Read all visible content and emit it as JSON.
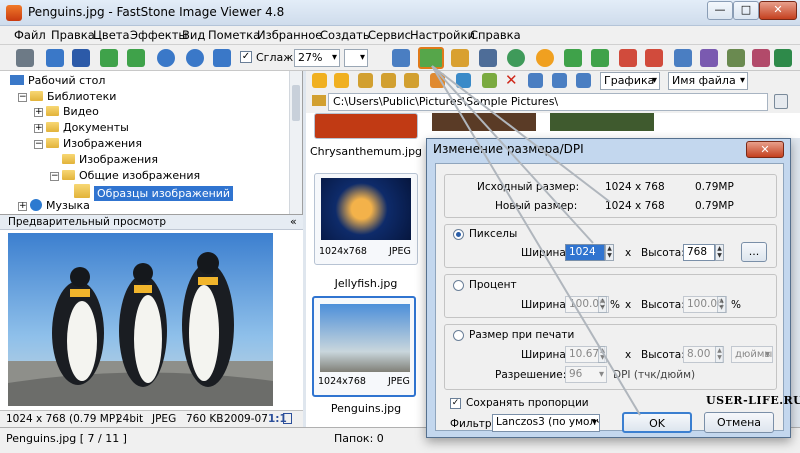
{
  "window": {
    "title": "Penguins.jpg  -  FastStone Image Viewer 4.8",
    "min_label": "—",
    "max_label": "□",
    "close_label": "✕"
  },
  "menu": [
    "Файл",
    "Правка",
    "Цвета",
    "Эффекты",
    "Вид",
    "Пометка",
    "Избранное",
    "Создать",
    "Сервис",
    "Настройки",
    "Справка"
  ],
  "toolbar1": {
    "smooth_label": "Сглаж.",
    "zoom_value": "27%"
  },
  "tree": {
    "desktop": "Рабочий стол",
    "libraries": "Библиотеки",
    "video": "Видео",
    "documents": "Документы",
    "images": "Изображения",
    "images_sub": "Изображения",
    "public_images": "Общие изображения",
    "sample_images": "Образцы изображений",
    "music": "Музыка"
  },
  "preview": {
    "header": "Предварительный просмотр",
    "header_icon": "«"
  },
  "infobar": {
    "dims": "1024 x 768 (0.79 MP)",
    "depth": "24bit",
    "format": "JPEG",
    "size": "760 KB",
    "date": "2009-07-14",
    "ratio": "1:1"
  },
  "status": {
    "file": "Penguins.jpg [ 7 / 11 ]",
    "folders": "Папок: 0"
  },
  "toolbar2": {
    "view_select": "Графика",
    "sort_select": "Имя файла"
  },
  "path": "C:\\Users\\Public\\Pictures\\Sample Pictures\\",
  "thumbnails": [
    {
      "name": "Chrysanthemum.jpg"
    },
    {
      "dims": "1024x768",
      "format": "JPEG",
      "name": "Jellyfish.jpg"
    },
    {
      "dims": "1024x768",
      "format": "JPEG",
      "name": "Penguins.jpg"
    }
  ],
  "dialog": {
    "title": "Изменение размера/DPI",
    "close": "✕",
    "orig_label": "Исходный размер:",
    "orig_dims": "1024 x 768",
    "orig_mp": "0.79MP",
    "new_label": "Новый размер:",
    "new_dims": "1024 x 768",
    "new_mp": "0.79MP",
    "pixels_label": "Пикселы",
    "width_label": "Ширина:",
    "height_label": "Высота:",
    "px_width": "1024",
    "px_height": "768",
    "times": "x",
    "dots_button": "...",
    "percent_label": "Процент",
    "pct_width": "100.00",
    "pct_height": "100.00",
    "pct_unit": "%",
    "print_label": "Размер при печати",
    "print_width": "10.67",
    "print_height": "8.00",
    "print_unit": "дюймы",
    "resolution_label": "Разрешение:",
    "resolution": "96",
    "dpi_unit": "DPI (тчк/дюйм)",
    "keep_ratio": "Сохранять пропорции",
    "watermark": "USER-LIFE.RU",
    "filter_label": "Фильтр:",
    "filter": "Lanczos3 (по умолч.",
    "ok": "OK",
    "cancel": "Отмена"
  }
}
